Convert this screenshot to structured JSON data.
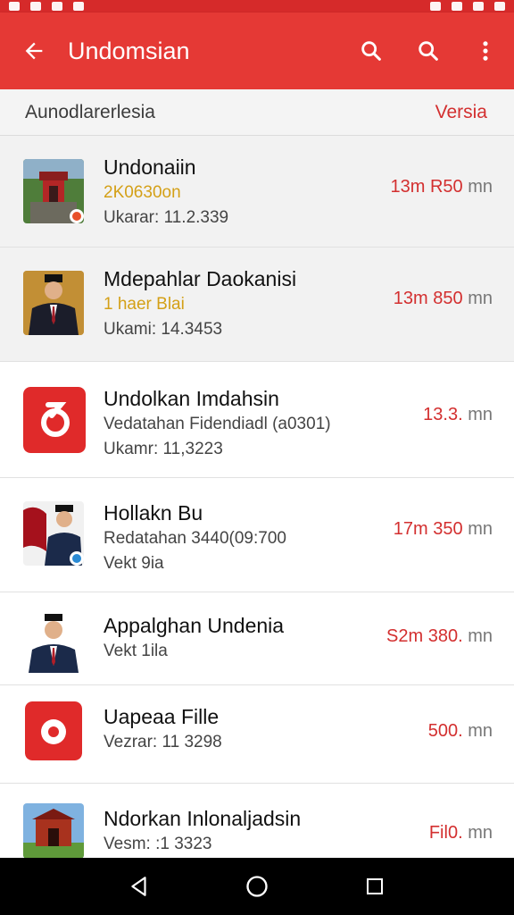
{
  "app_bar": {
    "title": "Undomsian"
  },
  "sub_header": {
    "title": "Aunodlarerlesia",
    "link": "Versia"
  },
  "items": [
    {
      "title": "Undonaiin",
      "line2": "2K0630on",
      "line3": "Ukarar: 11.2.339",
      "meta_red": "13m R50",
      "meta_grey": "mn"
    },
    {
      "title": "Mdepahlar Daokanisi",
      "line2": "1 haer Blai",
      "line3": "Ukami: 14.3453",
      "meta_red": "13m 850",
      "meta_grey": "mn"
    },
    {
      "title": "Undolkan Imdahsin",
      "line2": "Vedatahan Fidendiadl (a0301)",
      "line3": "Ukamr: 11,3223",
      "meta_red": "13.3.",
      "meta_grey": "mn"
    },
    {
      "title": "Hollakn Bu",
      "line2": "Redatahan 3440(09:700",
      "line3": "Vekt 9ia",
      "meta_red": "17m 350",
      "meta_grey": "mn"
    },
    {
      "title": "Appalghan Undenia",
      "line2": "Vekt 1ila",
      "line3": "",
      "meta_red": "S2m 380.",
      "meta_grey": "mn"
    },
    {
      "title": "Uapeaa Fille",
      "line2": "Vezrar: 11 3298",
      "line3": "",
      "meta_red": "500.",
      "meta_grey": "mn"
    },
    {
      "title": "Ndorkan Inlonaljadsin",
      "line2": "Vesm: :1 3323",
      "line3": "",
      "meta_red": "Fil0.",
      "meta_grey": "mn"
    }
  ],
  "icons": {
    "back": "arrow-back-icon",
    "search": "search-icon",
    "more": "more-vert-icon",
    "nav_back": "triangle-back-icon",
    "nav_home": "circle-home-icon",
    "nav_recents": "square-recents-icon"
  },
  "colors": {
    "app_bar": "#e53935",
    "accent_red": "#d32f2f",
    "highlight_yellow": "#d4a017"
  }
}
